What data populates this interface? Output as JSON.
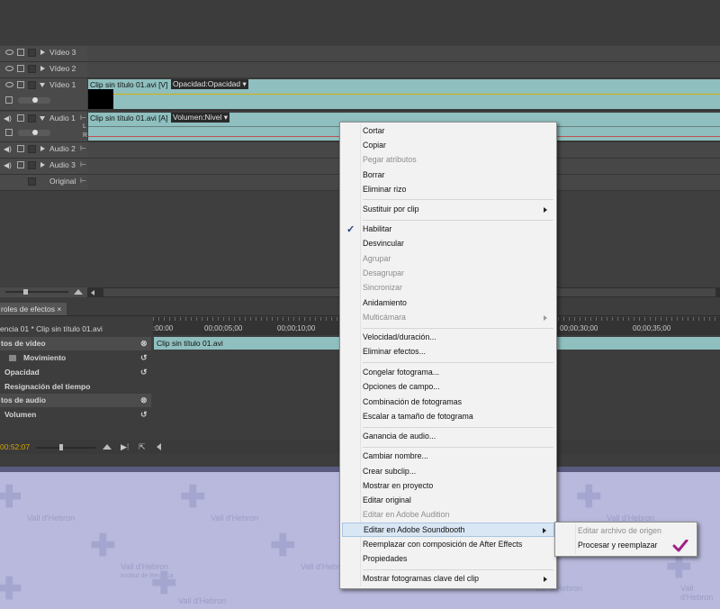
{
  "tracks": {
    "video3": "Vídeo 3",
    "video2": "Vídeo 2",
    "video1": "Vídeo 1",
    "audio1": "Audio 1",
    "audio2": "Audio 2",
    "audio3": "Audio 3",
    "original": "Original"
  },
  "clips": {
    "video_clip": "Clip sin título 01.avi [V]",
    "video_property": "Opacidad:Opacidad ▾",
    "audio_clip": "Clip sin título 01.avi [A]",
    "audio_property": "Volumen:Nivel ▾",
    "audio_channel_l": "L",
    "audio_channel_r": "R"
  },
  "effect_controls": {
    "tab_label": "roles de efectos ×",
    "sequence_label": "encia 01 * Clip sin título 01.avi",
    "timecodes": [
      ":00:00",
      "00;00;05;00",
      "00;00;10;00",
      "00;00;30;00",
      "00;00;35;00"
    ],
    "clip_label": "Clip sin título 01.avi",
    "rows": [
      {
        "label": "tos de vídeo"
      },
      {
        "label": "Movimiento"
      },
      {
        "label": "Opacidad"
      },
      {
        "label": "Resignación del tiempo"
      },
      {
        "label": "tos de audio"
      },
      {
        "label": "Volumen"
      }
    ],
    "current_time": "00:52:07"
  },
  "desktop": {
    "watermark_name": "Vall d'Hebron",
    "watermark_sub": "Institut de Recerca"
  },
  "context_menu": {
    "items": [
      {
        "label": "Cortar",
        "disabled": false
      },
      {
        "label": "Copiar",
        "disabled": false
      },
      {
        "label": "Pegar atributos",
        "disabled": true
      },
      {
        "label": "Borrar",
        "disabled": false
      },
      {
        "label": "Eliminar rizo",
        "disabled": false
      },
      {
        "label": "Sustituir por clip",
        "disabled": false
      },
      {
        "label": "Habilitar",
        "disabled": false
      },
      {
        "label": "Desvincular",
        "disabled": false
      },
      {
        "label": "Agrupar",
        "disabled": true
      },
      {
        "label": "Desagrupar",
        "disabled": true
      },
      {
        "label": "Sincronizar",
        "disabled": true
      },
      {
        "label": "Anidamiento",
        "disabled": false
      },
      {
        "label": "Multicámara",
        "disabled": true
      },
      {
        "label": "Velocidad/duración...",
        "disabled": false
      },
      {
        "label": "Eliminar efectos...",
        "disabled": false
      },
      {
        "label": "Congelar fotograma...",
        "disabled": false
      },
      {
        "label": "Opciones de campo...",
        "disabled": false
      },
      {
        "label": "Combinación de fotogramas",
        "disabled": false
      },
      {
        "label": "Escalar a tamaño de fotograma",
        "disabled": false
      },
      {
        "label": "Ganancia de audio...",
        "disabled": false
      },
      {
        "label": "Cambiar nombre...",
        "disabled": false
      },
      {
        "label": "Crear subclip...",
        "disabled": false
      },
      {
        "label": "Mostrar en proyecto",
        "disabled": false
      },
      {
        "label": "Editar original",
        "disabled": false
      },
      {
        "label": "Editar en Adobe Audition",
        "disabled": true
      },
      {
        "label": "Editar en Adobe Soundbooth",
        "disabled": false
      },
      {
        "label": "Reemplazar con composición de After Effects",
        "disabled": false
      },
      {
        "label": "Propiedades",
        "disabled": false
      },
      {
        "label": "Mostrar fotogramas clave del clip",
        "disabled": false
      }
    ],
    "check_glyph": "✓"
  },
  "sub_menu": {
    "items": [
      {
        "label": "Editar archivo de origen",
        "disabled": true
      },
      {
        "label": "Procesar y reemplazar",
        "disabled": false
      }
    ]
  },
  "colors": {
    "clip": "#8fbfbf",
    "menu_bg": "#f2f2f2",
    "highlight": "#d9e6f4",
    "cursor_check": "#a0208a"
  }
}
